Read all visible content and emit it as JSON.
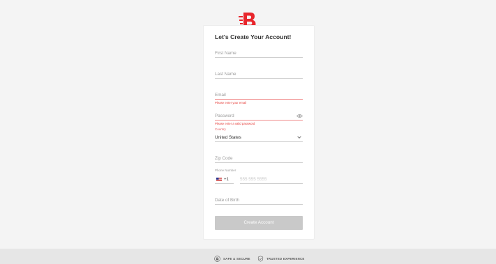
{
  "brand": {
    "logo_letter": "B",
    "color": "#e8262c"
  },
  "form": {
    "title": "Let's Create Your Account!",
    "first_name_placeholder": "First Name",
    "last_name_placeholder": "Last Name",
    "email_placeholder": "Email",
    "email_error": "Please enter your email",
    "password_placeholder": "Password",
    "password_error": "Please enter a valid password",
    "country_label": "Country",
    "country_value": "United States",
    "zip_placeholder": "Zip Code",
    "phone_label": "Phone Number",
    "phone_code": "+1",
    "phone_placeholder": "555 555 5555",
    "dob_placeholder": "Date of Birth",
    "submit_label": "Create Account"
  },
  "footer": {
    "safe_label": "SAFE & SECURE",
    "trusted_label": "TRUSTED EXPERIENCE"
  },
  "colors": {
    "error": "#e53935",
    "button_disabled": "#c9c9c9",
    "background": "#f4f4f4"
  }
}
